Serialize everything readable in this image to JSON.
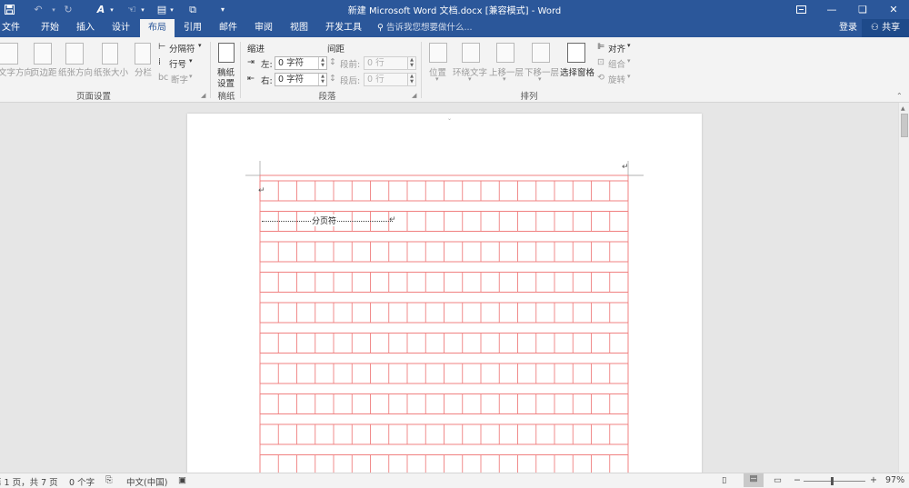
{
  "titlebar": {
    "title": "新建 Microsoft Word 文档.docx [兼容模式] - Word",
    "save_icon": "save-icon",
    "undo_icon": "undo-icon",
    "redo_icon": "redo-icon",
    "ribbon_display_icon": "ribbon-display-options-icon",
    "minimize": "—",
    "restore": "❏",
    "close": "✕"
  },
  "tabs": [
    "文件",
    "开始",
    "插入",
    "设计",
    "布局",
    "引用",
    "邮件",
    "审阅",
    "视图",
    "开发工具"
  ],
  "active_tab": "布局",
  "tell_me": "告诉我您想要做什么...",
  "login": "登录",
  "share": "共享",
  "ribbon": {
    "page_setup": {
      "group_label": "页面设置",
      "text_direction": "文字方向",
      "margins": "页边距",
      "orientation": "纸张方向",
      "size": "纸张大小",
      "columns": "分栏",
      "breaks": "分隔符",
      "line_numbers": "行号",
      "hyphenation": "断字"
    },
    "manuscript": {
      "group_label": "稿纸",
      "button_line1": "稿纸",
      "button_line2": "设置"
    },
    "paragraph": {
      "group_label": "段落",
      "indent_title": "缩进",
      "spacing_title": "间距",
      "left_label": "左:",
      "right_label": "右:",
      "left_value": "0 字符",
      "right_value": "0 字符",
      "before_label": "段前:",
      "after_label": "段后:",
      "before_value": "0 行",
      "after_value": "0 行"
    },
    "arrange": {
      "group_label": "排列",
      "position": "位置",
      "wrap_text": "环绕文字",
      "bring_forward": "上移一层",
      "send_backward": "下移一层",
      "selection_pane": "选择窗格",
      "align": "对齐",
      "group": "组合",
      "rotate": "旋转"
    }
  },
  "document": {
    "page_break_label": "分页符",
    "paragraph_mark": "↵",
    "grid_color": "#f08080"
  },
  "status": {
    "page": "第 1 页，共 7 页",
    "words": "0 个字",
    "language": "中文(中国)",
    "zoom": "97%"
  }
}
